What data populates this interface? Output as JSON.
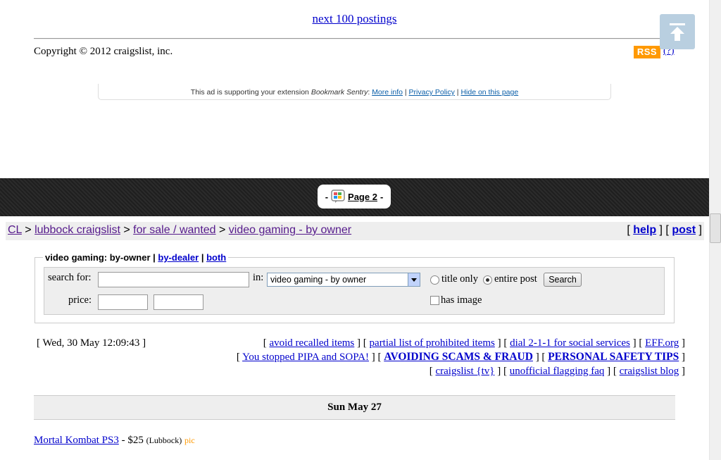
{
  "pager": {
    "next_label": "next 100 postings"
  },
  "footer": {
    "copyright": "Copyright © 2012 craigslist, inc.",
    "rss": "RSS",
    "rss_help": "(?)"
  },
  "ad": {
    "prefix": "This ad is supporting your extension ",
    "extension": "Bookmark Sentry",
    "colon": ": ",
    "more": "More info",
    "privacy": "Privacy Policy",
    "hide": "Hide on this page",
    "sep": " | "
  },
  "page_marker": {
    "label": "Page 2"
  },
  "breadcrumbs": {
    "cl": "CL",
    "city": "lubbock craigslist",
    "section": "for sale / wanted",
    "category": "video gaming - by owner",
    "sep": " > "
  },
  "header_links": {
    "help": "help",
    "post": "post"
  },
  "search": {
    "legend_current": "video gaming: by-owner",
    "legend_dealer": "by-dealer",
    "legend_both": "both",
    "search_for_label": "search for:",
    "in_label": "in:",
    "category_value": "video gaming - by owner",
    "title_only": "title only",
    "entire_post": "entire post",
    "search_button": "Search",
    "price_label": "price:",
    "has_image": "has image"
  },
  "timestamp": "[ Wed, 30 May 12:09:43 ]",
  "links": {
    "avoid_recalled": "avoid recalled items",
    "prohibited": "partial list of prohibited items",
    "dial211": "dial 2-1-1 for social services",
    "eff": "EFF.org",
    "pipa": "You stopped PIPA and SOPA!",
    "scams": "AVOIDING SCAMS & FRAUD",
    "safety": "PERSONAL SAFETY TIPS",
    "cltv": "craigslist {tv}",
    "flagging": "unofficial flagging faq",
    "blog": "craigslist blog"
  },
  "day_header": "Sun May 27",
  "postings": [
    {
      "title": "Mortal Kombat PS3",
      "price": " - $25 ",
      "location": "(Lubbock)",
      "pic": "pic"
    }
  ]
}
